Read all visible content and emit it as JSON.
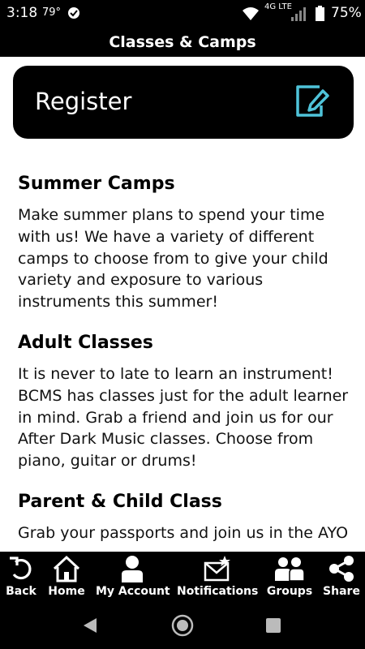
{
  "status_bar": {
    "time": "3:18",
    "temperature": "79°",
    "network": "4G LTE",
    "battery": "75%"
  },
  "header": {
    "title": "Classes & Camps"
  },
  "register": {
    "label": "Register",
    "icon": "edit-icon"
  },
  "sections": [
    {
      "title": "Summer Camps",
      "body": "Make summer plans to spend your time with us! We have a variety of different camps to choose from to give your child variety and exposure to various instruments this summer!"
    },
    {
      "title": "Adult Classes",
      "body": "It is never to late to learn an instrument! BCMS has classes just for the adult learner in mind. Grab a friend and join us for our After Dark Music classes. Choose from piano, guitar or drums!"
    },
    {
      "title": "Parent & Child Class",
      "body": "Grab your passports and join us in the AYO"
    }
  ],
  "bottom_nav": [
    {
      "label": "Back",
      "icon": "back-icon"
    },
    {
      "label": "Home",
      "icon": "home-icon"
    },
    {
      "label": "My Account",
      "icon": "account-icon"
    },
    {
      "label": "Notifications",
      "icon": "notifications-icon"
    },
    {
      "label": "Groups",
      "icon": "groups-icon"
    },
    {
      "label": "Share",
      "icon": "share-icon"
    }
  ],
  "colors": {
    "bar": "#000000",
    "register_icon": "#4fc3d9",
    "system_nav": "#000000"
  }
}
